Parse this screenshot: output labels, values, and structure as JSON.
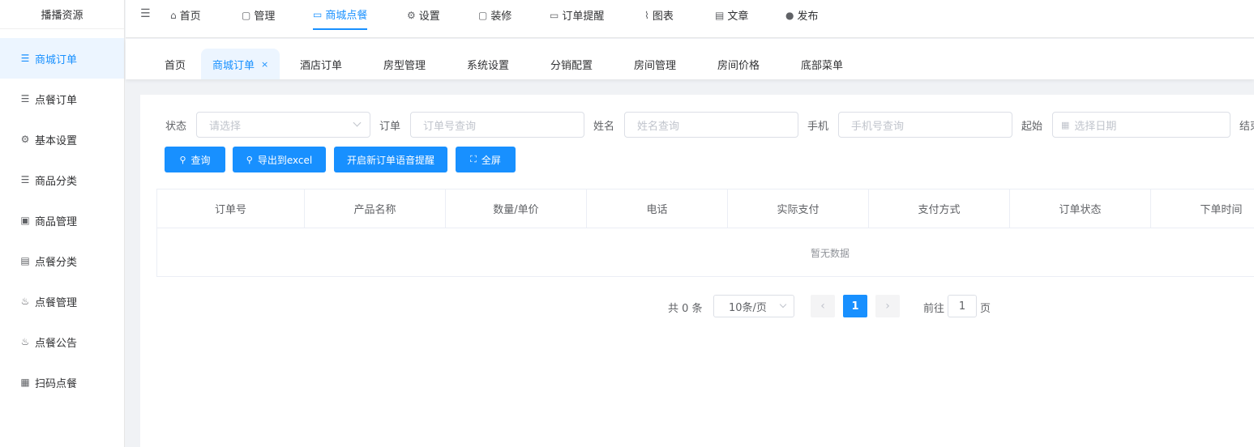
{
  "sidebar": {
    "brand": "播播资源",
    "items": [
      {
        "label": "商城订单",
        "icon": "list-icon",
        "glyph": "☰"
      },
      {
        "label": "点餐订单",
        "icon": "list-icon",
        "glyph": "☰"
      },
      {
        "label": "基本设置",
        "icon": "gear-icon",
        "glyph": "⚙"
      },
      {
        "label": "商品分类",
        "icon": "list-plus-icon",
        "glyph": "☰"
      },
      {
        "label": "商品管理",
        "icon": "box-icon",
        "glyph": "▣"
      },
      {
        "label": "点餐分类",
        "icon": "document-icon",
        "glyph": "▤"
      },
      {
        "label": "点餐管理",
        "icon": "bowl-icon",
        "glyph": "♨"
      },
      {
        "label": "点餐公告",
        "icon": "bowl-icon",
        "glyph": "♨"
      },
      {
        "label": "扫码点餐",
        "icon": "qrcode-icon",
        "glyph": "▦"
      }
    ]
  },
  "topnav": {
    "collapse_glyph": "☰",
    "items": [
      {
        "label": "首页",
        "icon": "home-icon",
        "glyph": "⌂"
      },
      {
        "label": "管理",
        "icon": "edit-icon",
        "glyph": "▢"
      },
      {
        "label": "商城点餐",
        "icon": "chat-icon",
        "glyph": "▭"
      },
      {
        "label": "设置",
        "icon": "gear-icon",
        "glyph": "⚙"
      },
      {
        "label": "装修",
        "icon": "edit-icon",
        "glyph": "▢"
      },
      {
        "label": "订单提醒",
        "icon": "chat-icon",
        "glyph": "▭"
      },
      {
        "label": "图表",
        "icon": "chart-icon",
        "glyph": "⌇"
      },
      {
        "label": "文章",
        "icon": "document-icon",
        "glyph": "▤"
      },
      {
        "label": "发布",
        "icon": "wechat-icon",
        "glyph": "●"
      }
    ]
  },
  "tabs": [
    {
      "label": "首页"
    },
    {
      "label": "商城订单",
      "close": "×"
    },
    {
      "label": "酒店订单"
    },
    {
      "label": "房型管理"
    },
    {
      "label": "系统设置"
    },
    {
      "label": "分销配置"
    },
    {
      "label": "房间管理"
    },
    {
      "label": "房间价格"
    },
    {
      "label": "底部菜单"
    }
  ],
  "filters": {
    "status_label": "状态",
    "status_placeholder": "请选择",
    "order_label": "订单",
    "order_placeholder": "订单号查询",
    "name_label": "姓名",
    "name_placeholder": "姓名查询",
    "phone_label": "手机",
    "phone_placeholder": "手机号查询",
    "start_label": "起始",
    "start_placeholder": "选择日期",
    "end_label": "结束"
  },
  "buttons": {
    "search": "查询",
    "export": "导出到excel",
    "voice": "开启新订单语音提醒",
    "fullscreen": "全屏"
  },
  "table": {
    "columns": [
      "订单号",
      "产品名称",
      "数量/单价",
      "电话",
      "实际支付",
      "支付方式",
      "订单状态",
      "下单时间"
    ],
    "empty_text": "暂无数据"
  },
  "pagination": {
    "total": "共 0 条",
    "page_size": "10条/页",
    "prev": "‹",
    "current": "1",
    "next": "›",
    "goto": "前往",
    "jump_value": "1",
    "page_unit": "页"
  },
  "colors": {
    "accent": "#1890ff",
    "active_bg": "#ecf5ff"
  }
}
